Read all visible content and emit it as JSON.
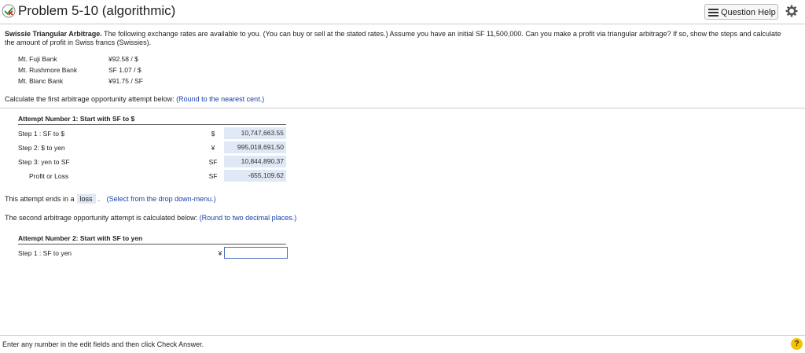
{
  "header": {
    "title": "Problem 5-10 (algorithmic)",
    "question_help": "Question Help",
    "status_icon": "partial-credit-icon",
    "settings_icon": "gear-icon"
  },
  "problem": {
    "heading": "Swissie Triangular Arbitrage.",
    "text": " The following exchange rates are available to you. (You can buy or sell at the stated rates.) Assume you have an initial SF 11,500,000. Can you make a profit via triangular arbitrage? If so, show the steps and calculate the amount of profit in Swiss francs (Swissies)."
  },
  "rates": [
    {
      "bank": "Mt. Fuji Bank",
      "rate": "¥92.58 / $"
    },
    {
      "bank": "Mt. Rushmore Bank",
      "rate": "SF 1.07 / $"
    },
    {
      "bank": "Mt. Blanc Bank",
      "rate": "¥91.75 / SF"
    }
  ],
  "q1": {
    "text": "Calculate the first arbitrage opportunity attempt below: ",
    "hint": "(Round to the nearest cent.)"
  },
  "attempt1": {
    "title": "Attempt Number 1: Start with SF to $",
    "rows": [
      {
        "label": "Step 1 : SF to $",
        "unit": "$",
        "value": "10,747,663.55"
      },
      {
        "label": "Step 2: $ to yen",
        "unit": "¥",
        "value": "995,018,691.50"
      },
      {
        "label": "Step 3: yen to SF",
        "unit": "SF",
        "value": "10,844,890.37"
      },
      {
        "label": "Profit or Loss",
        "unit": "SF",
        "value": "-655,109.62"
      }
    ]
  },
  "loss_line": {
    "pre": "This attempt ends in a",
    "value": "loss",
    "post": ".",
    "hint": "(Select from the drop down-menu.)"
  },
  "q2": {
    "text": "The second arbitrage opportunity attempt is calculated below: ",
    "hint": "(Round to two decimal places.)"
  },
  "attempt2": {
    "title": "Attempt Number 2: Start with SF to yen",
    "step1_label": "Step 1 : SF to yen",
    "step1_unit": "¥",
    "step1_value": ""
  },
  "footer": {
    "text": "Enter any number in the edit fields and then click Check Answer.",
    "help": "?"
  },
  "colors": {
    "accent_blue": "#1a3faa",
    "answer_bg": "#dfe8f4",
    "help_yellow": "#f3c300"
  }
}
